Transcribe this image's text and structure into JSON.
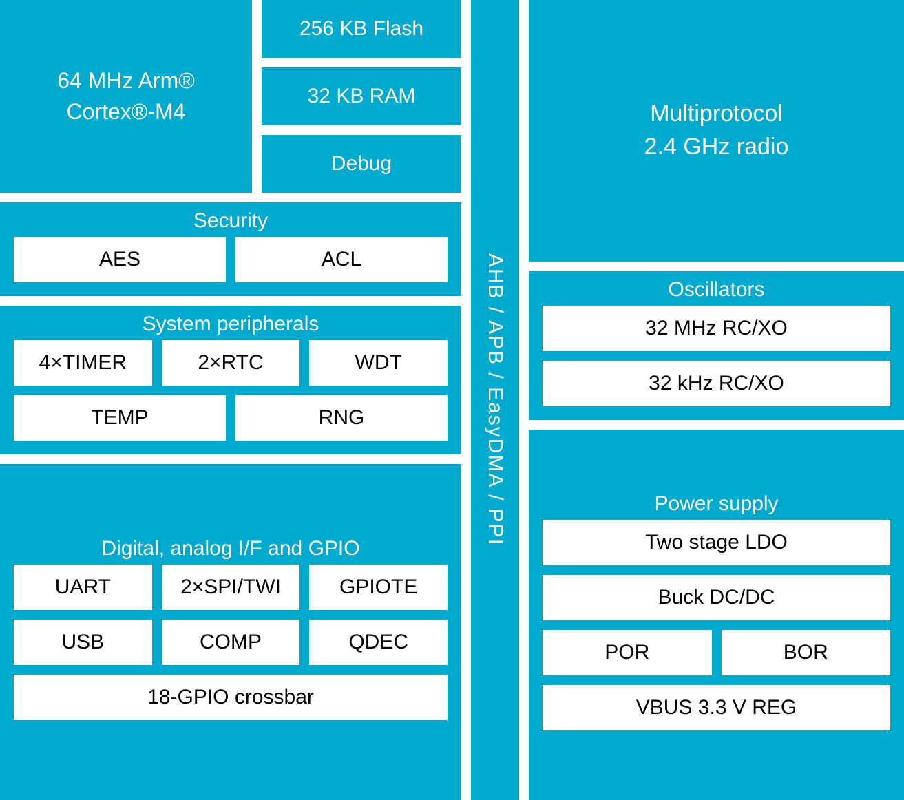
{
  "cpu": {
    "line1": "64 MHz Arm®",
    "line2": "Cortex®-M4"
  },
  "memory": {
    "flash": "256 KB Flash",
    "ram": "32 KB RAM",
    "debug": "Debug"
  },
  "security": {
    "title": "Security",
    "items": [
      "AES",
      "ACL"
    ]
  },
  "system_peripherals": {
    "title": "System peripherals",
    "row1": [
      "4×TIMER",
      "2×RTC",
      "WDT"
    ],
    "row2": [
      "TEMP",
      "RNG"
    ]
  },
  "digital": {
    "title": "Digital, analog I/F and GPIO",
    "row1": [
      "UART",
      "2×SPI/TWI",
      "GPIOTE"
    ],
    "row2": [
      "USB",
      "COMP",
      "QDEC"
    ],
    "crossbar": "18-GPIO crossbar"
  },
  "bus": "AHB / APB / EasyDMA / PPI",
  "radio": {
    "line1": "Multiprotocol",
    "line2": "2.4 GHz radio"
  },
  "oscillators": {
    "title": "Oscillators",
    "items": [
      "32 MHz RC/XO",
      "32 kHz RC/XO"
    ]
  },
  "power_supply": {
    "title": "Power supply",
    "ldo": "Two stage LDO",
    "buck": "Buck DC/DC",
    "por": "POR",
    "bor": "BOR",
    "vbus": "VBUS 3.3 V REG"
  }
}
